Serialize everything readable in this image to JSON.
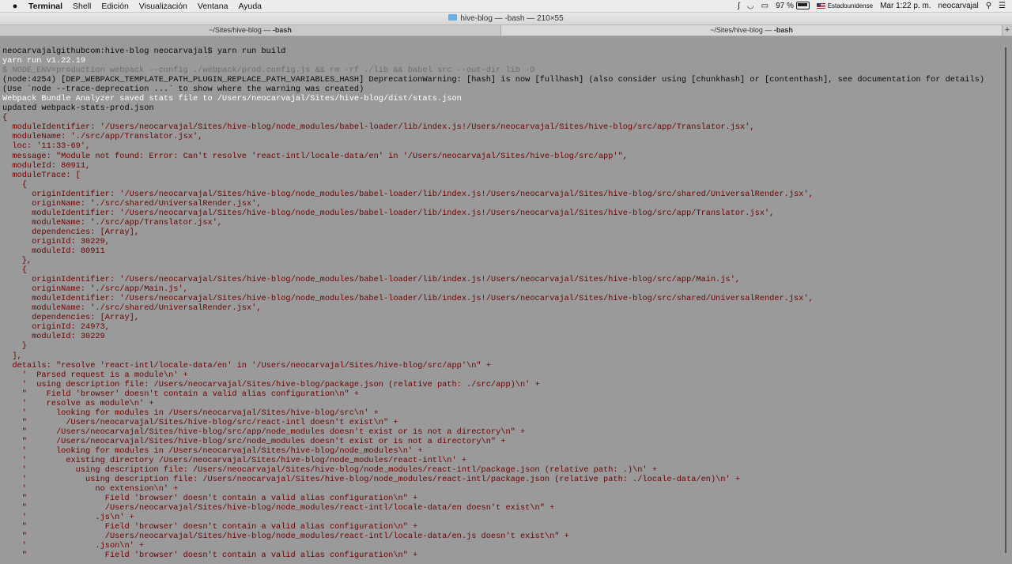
{
  "menubar": {
    "apple_icon": "apple-logo-icon",
    "app_name": "Terminal",
    "items": [
      "Shell",
      "Edición",
      "Visualización",
      "Ventana",
      "Ayuda"
    ],
    "status": {
      "battery": "97 %",
      "input_source": "Estadounidense",
      "clock": "Mar 1:22 p. m.",
      "user": "neocarvajal"
    }
  },
  "window": {
    "title": "hive-blog — -bash — 210×55"
  },
  "tabs": [
    {
      "path": "~/Sites/hive-blog — ",
      "cmd": "-bash"
    },
    {
      "path": "~/Sites/hive-blog — ",
      "cmd": "-bash"
    }
  ],
  "terminal": {
    "lines": [
      {
        "t": "neocarvajalgithubcom:hive-blog neocarvajal$ yarn run build",
        "c": "black"
      },
      {
        "t": "yarn run v1.22.19",
        "c": "white"
      },
      {
        "t": "$ NODE_ENV=production webpack --config ./webpack/prod.config.js && rm -rf ./lib && babel src --out-dir lib -D",
        "c": "gray"
      },
      {
        "t": "(node:4254) [DEP_WEBPACK_TEMPLATE_PATH_PLUGIN_REPLACE_PATH_VARIABLES_HASH] DeprecationWarning: [hash] is now [fullhash] (also consider using [chunkhash] or [contenthash], see documentation for details)",
        "c": "black"
      },
      {
        "t": "(Use `node --trace-deprecation ...` to show where the warning was created)",
        "c": "black"
      },
      {
        "t": "Webpack Bundle Analyzer saved stats file to /Users/neocarvajal/Sites/hive-blog/dist/stats.json",
        "c": "white"
      },
      {
        "t": "updated webpack-stats-prod.json",
        "c": "black"
      },
      {
        "t": "{",
        "c": "red"
      },
      {
        "t": "  moduleIdentifier: '/Users/neocarvajal/Sites/hive-blog/node_modules/babel-loader/lib/index.js!/Users/neocarvajal/Sites/hive-blog/src/app/Translator.jsx',",
        "c": "red"
      },
      {
        "t": "  moduleName: './src/app/Translator.jsx',",
        "c": "red"
      },
      {
        "t": "  loc: '11:33-69',",
        "c": "red"
      },
      {
        "t": "  message: \"Module not found: Error: Can't resolve 'react-intl/locale-data/en' in '/Users/neocarvajal/Sites/hive-blog/src/app'\",",
        "c": "red"
      },
      {
        "t": "  moduleId: 80911,",
        "c": "red"
      },
      {
        "t": "  moduleTrace: [",
        "c": "red"
      },
      {
        "t": "    {",
        "c": "red"
      },
      {
        "t": "      originIdentifier: '/Users/neocarvajal/Sites/hive-blog/node_modules/babel-loader/lib/index.js!/Users/neocarvajal/Sites/hive-blog/src/shared/UniversalRender.jsx',",
        "c": "red"
      },
      {
        "t": "      originName: './src/shared/UniversalRender.jsx',",
        "c": "red"
      },
      {
        "t": "      moduleIdentifier: '/Users/neocarvajal/Sites/hive-blog/node_modules/babel-loader/lib/index.js!/Users/neocarvajal/Sites/hive-blog/src/app/Translator.jsx',",
        "c": "red"
      },
      {
        "t": "      moduleName: './src/app/Translator.jsx',",
        "c": "red"
      },
      {
        "t": "      dependencies: [Array],",
        "c": "red"
      },
      {
        "t": "      originId: 30229,",
        "c": "red"
      },
      {
        "t": "      moduleId: 80911",
        "c": "red"
      },
      {
        "t": "    },",
        "c": "red"
      },
      {
        "t": "    {",
        "c": "red"
      },
      {
        "t": "      originIdentifier: '/Users/neocarvajal/Sites/hive-blog/node_modules/babel-loader/lib/index.js!/Users/neocarvajal/Sites/hive-blog/src/app/Main.js',",
        "c": "red"
      },
      {
        "t": "      originName: './src/app/Main.js',",
        "c": "red"
      },
      {
        "t": "      moduleIdentifier: '/Users/neocarvajal/Sites/hive-blog/node_modules/babel-loader/lib/index.js!/Users/neocarvajal/Sites/hive-blog/src/shared/UniversalRender.jsx',",
        "c": "red"
      },
      {
        "t": "      moduleName: './src/shared/UniversalRender.jsx',",
        "c": "red"
      },
      {
        "t": "      dependencies: [Array],",
        "c": "red"
      },
      {
        "t": "      originId: 24973,",
        "c": "red"
      },
      {
        "t": "      moduleId: 30229",
        "c": "red"
      },
      {
        "t": "    }",
        "c": "red"
      },
      {
        "t": "  ],",
        "c": "red"
      },
      {
        "t": "  details: \"resolve 'react-intl/locale-data/en' in '/Users/neocarvajal/Sites/hive-blog/src/app'\\n\" +",
        "c": "red"
      },
      {
        "t": "    '  Parsed request is a module\\n' +",
        "c": "red"
      },
      {
        "t": "    '  using description file: /Users/neocarvajal/Sites/hive-blog/package.json (relative path: ./src/app)\\n' +",
        "c": "red"
      },
      {
        "t": "    \"    Field 'browser' doesn't contain a valid alias configuration\\n\" +",
        "c": "red"
      },
      {
        "t": "    '    resolve as module\\n' +",
        "c": "red"
      },
      {
        "t": "    '      looking for modules in /Users/neocarvajal/Sites/hive-blog/src\\n' +",
        "c": "red"
      },
      {
        "t": "    \"        /Users/neocarvajal/Sites/hive-blog/src/react-intl doesn't exist\\n\" +",
        "c": "red"
      },
      {
        "t": "    \"      /Users/neocarvajal/Sites/hive-blog/src/app/node_modules doesn't exist or is not a directory\\n\" +",
        "c": "red"
      },
      {
        "t": "    \"      /Users/neocarvajal/Sites/hive-blog/src/node_modules doesn't exist or is not a directory\\n\" +",
        "c": "red"
      },
      {
        "t": "    '      looking for modules in /Users/neocarvajal/Sites/hive-blog/node_modules\\n' +",
        "c": "red"
      },
      {
        "t": "    '        existing directory /Users/neocarvajal/Sites/hive-blog/node_modules/react-intl\\n' +",
        "c": "red"
      },
      {
        "t": "    '          using description file: /Users/neocarvajal/Sites/hive-blog/node_modules/react-intl/package.json (relative path: .)\\n' +",
        "c": "red"
      },
      {
        "t": "    '            using description file: /Users/neocarvajal/Sites/hive-blog/node_modules/react-intl/package.json (relative path: ./locale-data/en)\\n' +",
        "c": "red"
      },
      {
        "t": "    '              no extension\\n' +",
        "c": "red"
      },
      {
        "t": "    \"                Field 'browser' doesn't contain a valid alias configuration\\n\" +",
        "c": "red"
      },
      {
        "t": "    \"                /Users/neocarvajal/Sites/hive-blog/node_modules/react-intl/locale-data/en doesn't exist\\n\" +",
        "c": "red"
      },
      {
        "t": "    '              .js\\n' +",
        "c": "red"
      },
      {
        "t": "    \"                Field 'browser' doesn't contain a valid alias configuration\\n\" +",
        "c": "red"
      },
      {
        "t": "    \"                /Users/neocarvajal/Sites/hive-blog/node_modules/react-intl/locale-data/en.js doesn't exist\\n\" +",
        "c": "red"
      },
      {
        "t": "    '              .json\\n' +",
        "c": "red"
      },
      {
        "t": "    \"                Field 'browser' doesn't contain a valid alias configuration\\n\" +",
        "c": "red"
      }
    ]
  }
}
